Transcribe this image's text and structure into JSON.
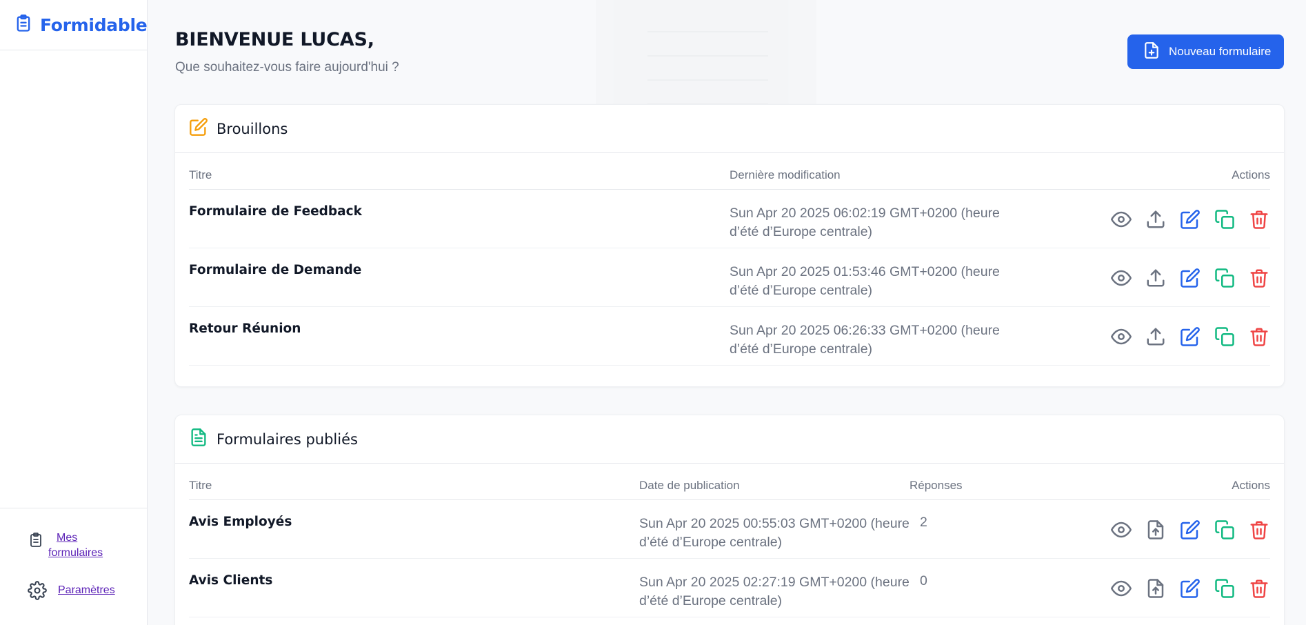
{
  "app": {
    "name": "Formidable"
  },
  "sidebar": {
    "items": [
      {
        "label_line1": "Mes",
        "label_line2": "formulaires",
        "icon": "clipboard-icon"
      },
      {
        "label": "Paramètres",
        "icon": "gear-icon"
      }
    ]
  },
  "header": {
    "title": "BIENVENUE LUCAS,",
    "subtitle": "Que souhaitez-vous faire aujourd'hui ?",
    "new_button": "Nouveau formulaire"
  },
  "drafts": {
    "title": "Brouillons",
    "columns": {
      "title": "Titre",
      "date": "Dernière modification",
      "actions": "Actions"
    },
    "rows": [
      {
        "title": "Formulaire de Feedback",
        "date_line1": "Sun Apr 20 2025 06:02:19 GMT+0200 (heure",
        "date_line2": "d’été d’Europe centrale)"
      },
      {
        "title": "Formulaire de Demande",
        "date_line1": "Sun Apr 20 2025 01:53:46 GMT+0200 (heure",
        "date_line2": "d’été d’Europe centrale)"
      },
      {
        "title": "Retour Réunion",
        "date_line1": "Sun Apr 20 2025 06:26:33 GMT+0200 (heure",
        "date_line2": "d’été d’Europe centrale)"
      }
    ]
  },
  "published": {
    "title": "Formulaires publiés",
    "columns": {
      "title": "Titre",
      "date": "Date de publication",
      "responses": "Réponses",
      "actions": "Actions"
    },
    "rows": [
      {
        "title": "Avis Employés",
        "date_line1": "Sun Apr 20 2025 00:55:03 GMT+0200 (heure",
        "date_line2": "d’été d’Europe centrale)",
        "responses": "2"
      },
      {
        "title": "Avis Clients",
        "date_line1": "Sun Apr 20 2025 02:27:19 GMT+0200 (heure",
        "date_line2": "d’été d’Europe centrale)",
        "responses": "0"
      }
    ]
  },
  "colors": {
    "primary": "#2563eb",
    "gray_icon": "#6b7280",
    "green_icon": "#10b981",
    "red_icon": "#ef4444",
    "orange_icon": "#f59e0b"
  }
}
